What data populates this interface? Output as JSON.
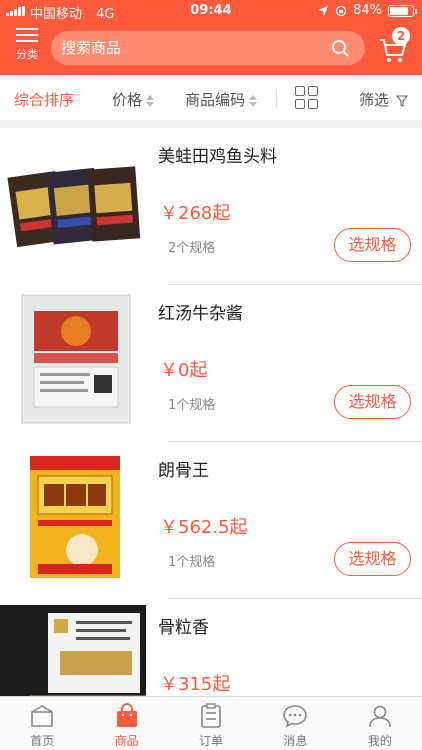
{
  "status_bar": {
    "carrier": "中国移动",
    "network": "4G",
    "time": "09:44",
    "battery": "84%",
    "battery_level": 0.84
  },
  "header": {
    "category_label": "分类",
    "search_placeholder": "搜索商品",
    "cart_count": "2"
  },
  "filters": {
    "comprehensive": "综合排序",
    "price": "价格",
    "code": "商品编码",
    "filter": "筛选"
  },
  "products": [
    {
      "name": "美蛙田鸡鱼头料",
      "price": "￥268起",
      "specs": "2个规格",
      "button": "选规格"
    },
    {
      "name": "红汤牛杂酱",
      "price": "￥0起",
      "specs": "1个规格",
      "button": "选规格"
    },
    {
      "name": "朗骨王",
      "price": "￥562.5起",
      "specs": "1个规格",
      "button": "选规格"
    },
    {
      "name": "骨粒香",
      "price": "￥315起",
      "specs": "",
      "button": ""
    }
  ],
  "tabbar": [
    {
      "label": "首页",
      "icon": "home-icon"
    },
    {
      "label": "商品",
      "icon": "bag-icon"
    },
    {
      "label": "订单",
      "icon": "order-icon"
    },
    {
      "label": "消息",
      "icon": "message-icon"
    },
    {
      "label": "我的",
      "icon": "user-icon"
    }
  ],
  "colors": {
    "brand": "#ff5a3c",
    "search_bg": "#ff8d71"
  }
}
